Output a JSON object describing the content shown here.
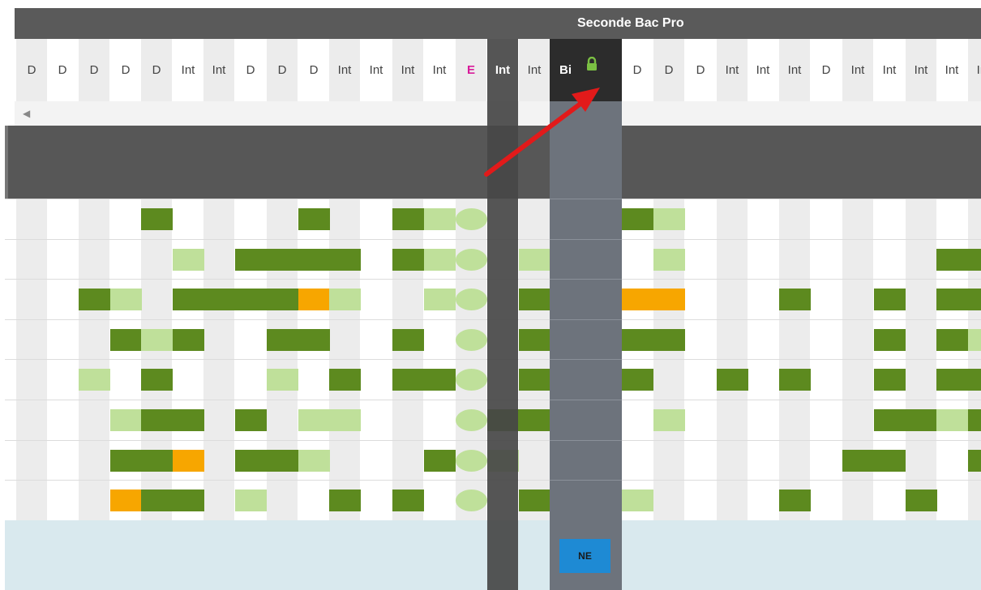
{
  "header": {
    "class_title": "Seconde Bac Pro"
  },
  "columns": [
    "D",
    "D",
    "D",
    "D",
    "D",
    "Int",
    "Int",
    "D",
    "D",
    "D",
    "Int",
    "Int",
    "Int",
    "Int",
    "E",
    "Int",
    "Int",
    "Bi",
    "D",
    "D",
    "D",
    "Int",
    "Int",
    "Int",
    "D",
    "Int",
    "Int",
    "Int",
    "Int",
    "Int"
  ],
  "special": {
    "E_color": "#d81b9a",
    "selected_label": "Bi",
    "lock_icon": "lock-icon"
  },
  "scroll": {
    "left_arrow": "◀"
  },
  "group_row": {
    "evaluation_icon": "evaluation-grid-icon",
    "evaluation_label": "++"
  },
  "footer": {
    "badge_label": "NE",
    "badge_color": "#1e8ad4"
  },
  "legend_colors": {
    "acquired": "#5d8a1f",
    "partial": "#bfe09a",
    "warning": "#f7a600",
    "dark_column": "#474747",
    "selected_column": "#6d737c"
  },
  "grid_rows": [
    [
      null,
      null,
      null,
      null,
      "a",
      null,
      null,
      null,
      null,
      "a",
      null,
      null,
      "a",
      "p",
      "p",
      null,
      null,
      null,
      "a",
      "p",
      null,
      null,
      null,
      null,
      null,
      null,
      null,
      null,
      null,
      null
    ],
    [
      null,
      null,
      null,
      null,
      null,
      "p",
      null,
      "a",
      "a",
      "a",
      "a",
      null,
      "a",
      "p",
      "p",
      null,
      "p",
      null,
      null,
      "p",
      null,
      null,
      null,
      null,
      null,
      null,
      null,
      null,
      "a",
      "a"
    ],
    [
      null,
      null,
      "a",
      "p",
      null,
      "a",
      "a",
      "a",
      "a",
      "o",
      "p",
      null,
      null,
      "p",
      "p",
      null,
      "a",
      null,
      "o",
      "o",
      null,
      null,
      null,
      "a",
      null,
      null,
      "a",
      null,
      "a",
      "a"
    ],
    [
      null,
      null,
      null,
      "a",
      "p",
      "a",
      null,
      null,
      "a",
      "a",
      null,
      null,
      "a",
      null,
      "p",
      null,
      "a",
      null,
      "a",
      "a",
      null,
      null,
      null,
      null,
      null,
      null,
      "a",
      null,
      "a",
      "p"
    ],
    [
      null,
      null,
      "p",
      null,
      "a",
      null,
      null,
      null,
      "p",
      null,
      "a",
      null,
      "a",
      "a",
      "p",
      null,
      "a",
      null,
      "a",
      null,
      null,
      "a",
      null,
      "a",
      null,
      null,
      "a",
      null,
      "a",
      "a"
    ],
    [
      null,
      null,
      null,
      "p",
      "a",
      "a",
      null,
      "a",
      null,
      "p",
      "p",
      null,
      null,
      null,
      "p",
      "a",
      "a",
      null,
      null,
      "p",
      null,
      null,
      null,
      null,
      null,
      null,
      "a",
      "a",
      "p",
      "a"
    ],
    [
      null,
      null,
      null,
      "a",
      "a",
      "o",
      null,
      "a",
      "a",
      "p",
      null,
      null,
      null,
      "a",
      "p",
      "p",
      null,
      null,
      null,
      null,
      null,
      null,
      null,
      null,
      null,
      "a",
      "a",
      null,
      null,
      "a"
    ],
    [
      null,
      null,
      null,
      "o",
      "a",
      "a",
      null,
      "p",
      null,
      null,
      "a",
      null,
      "a",
      null,
      "p",
      null,
      "a",
      null,
      "p",
      null,
      null,
      null,
      null,
      "a",
      null,
      null,
      null,
      "a",
      null,
      null
    ]
  ]
}
